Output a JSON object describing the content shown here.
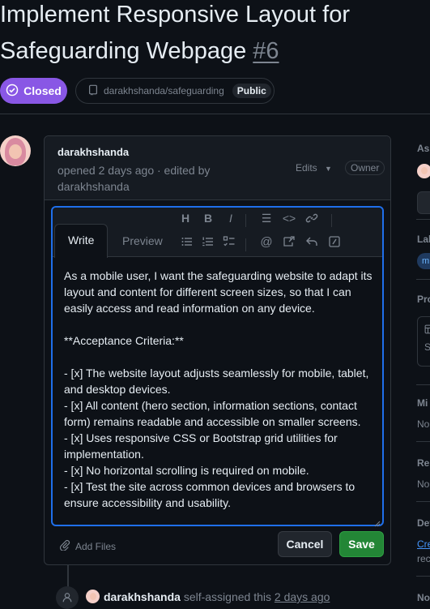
{
  "issue": {
    "title_line1": "Implement Responsive Layout for",
    "title_line2": "Safeguarding Webpage",
    "number": "#6",
    "state": "Closed",
    "repo": "darakhshanda/safeguarding",
    "visibility": "Public"
  },
  "comment": {
    "author": "darakhshanda",
    "meta": "opened 2 days ago · edited by darakhshanda",
    "edits_label": "Edits",
    "owner_badge": "Owner"
  },
  "editor": {
    "tab_write": "Write",
    "tab_preview": "Preview",
    "toolbar": [
      "heading-icon",
      "bold-icon",
      "italic-icon",
      "quote-icon",
      "code-icon",
      "link-icon",
      "unordered-list-icon",
      "ordered-list-icon",
      "task-list-icon",
      "mention-icon",
      "reference-icon",
      "reply-icon",
      "slash-commands-icon"
    ],
    "body": "As a mobile user, I want the safeguarding website to adapt its layout and content for different screen sizes, so that I can easily access and read information on any device.\n\n**Acceptance Criteria:**\n\n- [x] The website layout adjusts seamlessly for mobile, tablet, and desktop devices.\n- [x] All content (hero section, information sections, contact form) remains readable and accessible on smaller screens.\n- [x] Uses responsive CSS or Bootstrap grid utilities for implementation.\n- [x] No horizontal scrolling is required on mobile.\n- [x] Test the site across common devices and browsers to ensure accessibility and usability.",
    "add_files": "Add Files",
    "cancel_label": "Cancel",
    "save_label": "Save"
  },
  "timeline": {
    "actor": "darakhshanda",
    "action": " self-assigned this ",
    "time": "2 days ago"
  },
  "sidebar": {
    "assignees_label": "Ass",
    "labels_label": "Lab",
    "label_chip": "m",
    "projects_label": "Pro",
    "project_status": "S",
    "milestone_label": "Mi",
    "milestone_value": "No",
    "relationships_label": "Rel",
    "relationships_value": "No",
    "development_label": "Dev",
    "development_link": "Cre",
    "development_note": "rec",
    "notifications_label": "No"
  },
  "colors": {
    "closed": "#8957e5",
    "save": "#238636",
    "focus": "#1f6feb"
  }
}
